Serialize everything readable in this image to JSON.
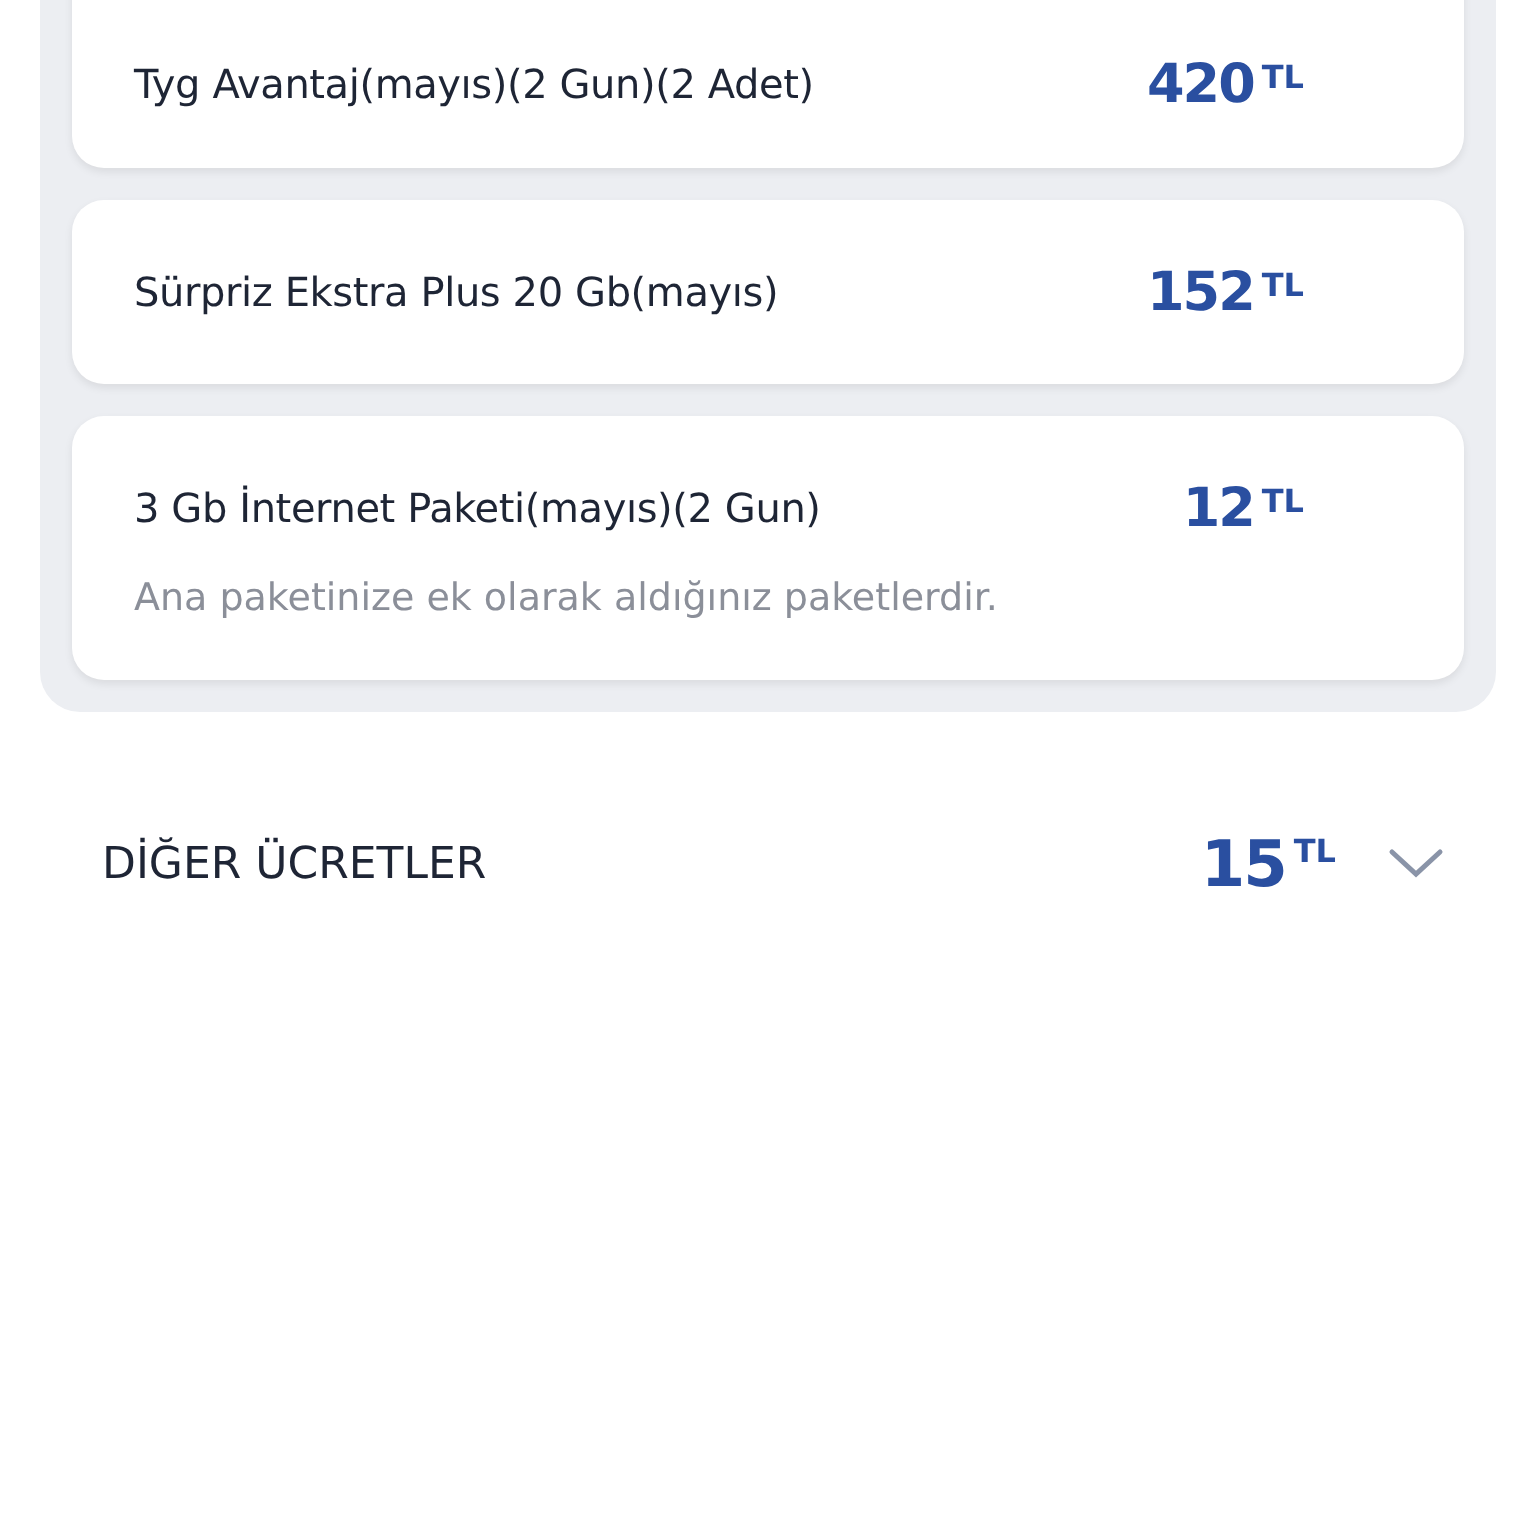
{
  "packages": [
    {
      "name": "Tyg Avantaj(mayıs)(2 Gun)(2 Adet)",
      "amount": "420",
      "currency": "TL"
    },
    {
      "name": "Sürpriz Ekstra Plus 20 Gb(mayıs)",
      "amount": "152",
      "currency": "TL"
    },
    {
      "name": "3 Gb İnternet Paketi(mayıs)(2 Gun)",
      "amount": "12",
      "currency": "TL",
      "note": "Ana paketinize ek olarak aldığınız paketlerdir."
    }
  ],
  "other_charges": {
    "label": "DİĞER ÜCRETLER",
    "amount": "15",
    "currency": "TL",
    "expanded": false
  }
}
